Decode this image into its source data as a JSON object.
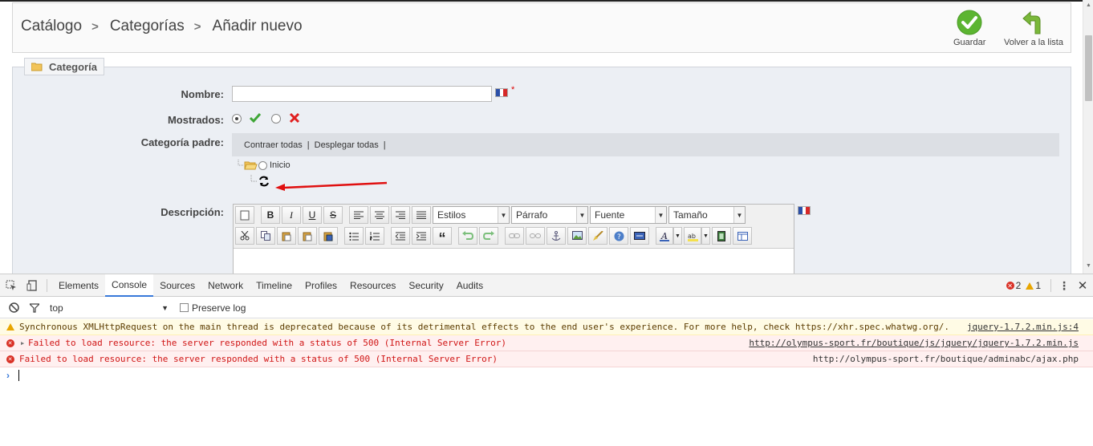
{
  "breadcrumb": [
    "Catálogo",
    "Categorías",
    "Añadir nuevo"
  ],
  "toolbar": {
    "save_label": "Guardar",
    "back_label": "Volver a la lista"
  },
  "form": {
    "legend": "Categoría",
    "name_label": "Nombre:",
    "name_value": "",
    "required_mark": "*",
    "shown_label": "Mostrados:",
    "parent_label": "Categoría padre:",
    "collapse_all": "Contraer todas",
    "expand_all": "Desplegar todas",
    "separator": "|",
    "tree_root": "Inicio",
    "description_label": "Descripción:"
  },
  "editor": {
    "styles": "Estilos",
    "paragraph": "Párrafo",
    "font": "Fuente",
    "size": "Tamaño"
  },
  "devtools": {
    "tabs": [
      "Elements",
      "Console",
      "Sources",
      "Network",
      "Timeline",
      "Profiles",
      "Resources",
      "Security",
      "Audits"
    ],
    "active_tab": "Console",
    "error_count": "2",
    "warning_count": "1",
    "context": "top",
    "preserve_log": "Preserve log",
    "messages": [
      {
        "level": "warning",
        "text": "Synchronous XMLHttpRequest on the main thread is deprecated because of its detrimental effects to the end user's experience. For more help, check https://xhr.spec.whatwg.org/.",
        "source": "jquery-1.7.2.min.js:4"
      },
      {
        "level": "error",
        "text": "Failed to load resource: the server responded with a status of 500 (Internal Server Error)",
        "source": "http://olympus-sport.fr/boutique/js/jquery/jquery-1.7.2.min.js"
      },
      {
        "level": "error",
        "text": "Failed to load resource: the server responded with a status of 500 (Internal Server Error)",
        "source": "http://olympus-sport.fr/boutique/adminabc/ajax.php"
      }
    ]
  },
  "colors": {
    "accent_green": "#5cb531",
    "error_red": "#d01515",
    "arrow_red": "#e01010",
    "tab_blue": "#3879d9"
  }
}
